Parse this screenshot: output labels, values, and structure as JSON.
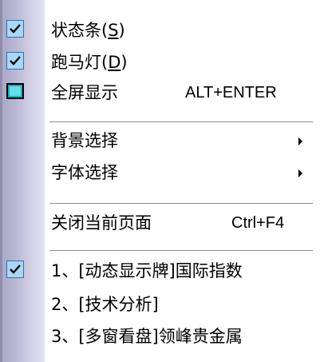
{
  "menu": {
    "items": [
      {
        "label": "状态条(",
        "mnemonic": "S",
        "suffix": ")",
        "checked": true
      },
      {
        "label": "跑马灯(",
        "mnemonic": "D",
        "suffix": ")",
        "checked": true
      },
      {
        "label": "全屏显示",
        "shortcut": "ALT+ENTER",
        "icon": "fullscreen-icon"
      },
      {
        "label": "背景选择",
        "submenu": true
      },
      {
        "label": "字体选择",
        "submenu": true
      },
      {
        "label": "关闭当前页面",
        "shortcut": "Ctrl+F4"
      },
      {
        "label": "1、[动态显示牌]国际指数",
        "checked": true
      },
      {
        "label": "2、[技术分析]"
      },
      {
        "label": "3、[多窗看盘]领峰贵金属"
      }
    ]
  },
  "colors": {
    "check_bg": "#a9d8f5",
    "check_border": "#2f6fb0",
    "gutter_dark": "#a8a7c4",
    "gutter_light": "#e4e3f1",
    "separator": "#8c8c99"
  }
}
